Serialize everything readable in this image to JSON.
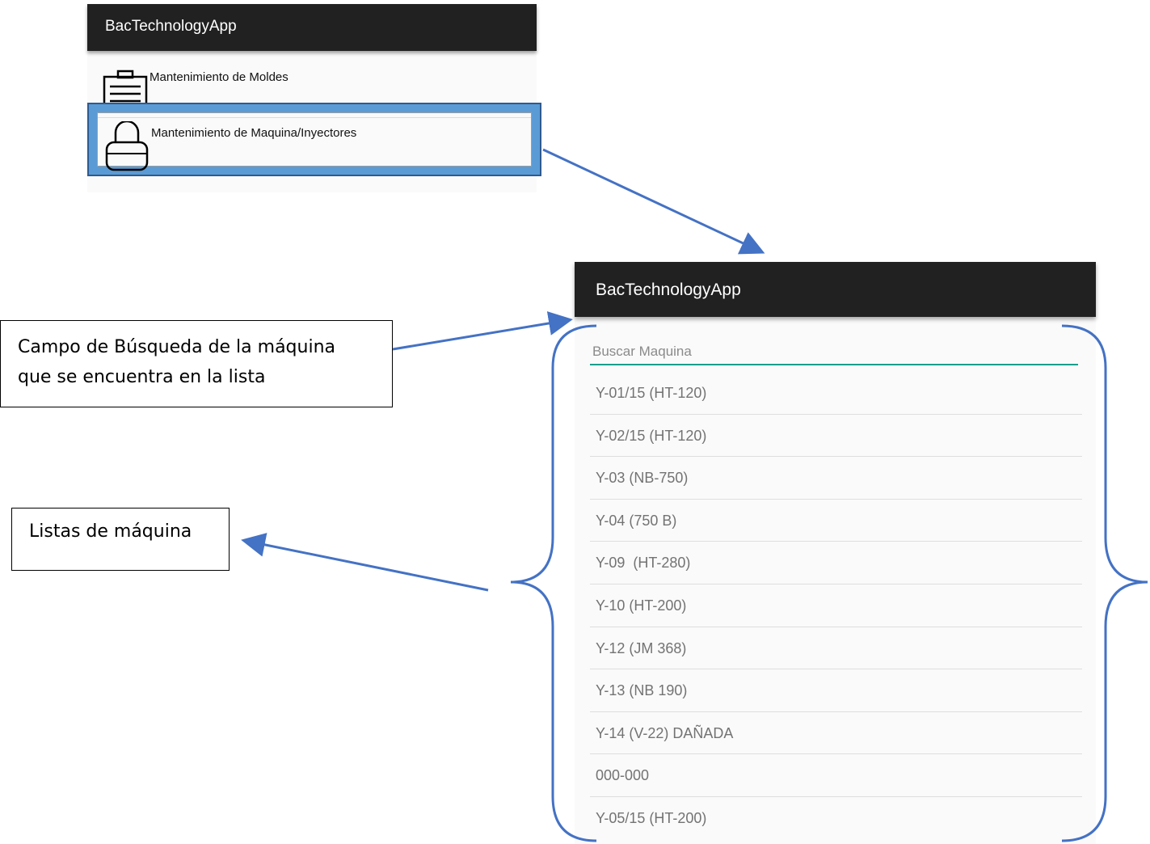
{
  "menu_screen": {
    "app_title": "BacTechnologyApp",
    "items": [
      {
        "label": "Mantenimiento de Moldes",
        "icon": "clipboard-icon"
      },
      {
        "label": "Mantenimiento de Maquina/Inyectores",
        "icon": "padlock-icon"
      }
    ],
    "highlight_color": "#5b9bd5"
  },
  "list_screen": {
    "app_title": "BacTechnologyApp",
    "search_placeholder": "Buscar Maquina",
    "search_underline_color": "#1a9e8c",
    "machines": [
      "Y-01/15 (HT-120)",
      "Y-02/15 (HT-120)",
      "Y-03 (NB-750)",
      "Y-04 (750 B)",
      "Y-09  (HT-280)",
      "Y-10 (HT-200)",
      "Y-12 (JM 368)",
      "Y-13 (NB 190)",
      "Y-14 (V-22) DAÑADA",
      "000-000",
      "Y-05/15 (HT-200)"
    ]
  },
  "annotations": {
    "search_note_line1": "Campo de Búsqueda de la máquina",
    "search_note_line2": "que se encuentra en la lista",
    "list_note": "Listas de máquina",
    "arrow_color": "#4472c4"
  }
}
